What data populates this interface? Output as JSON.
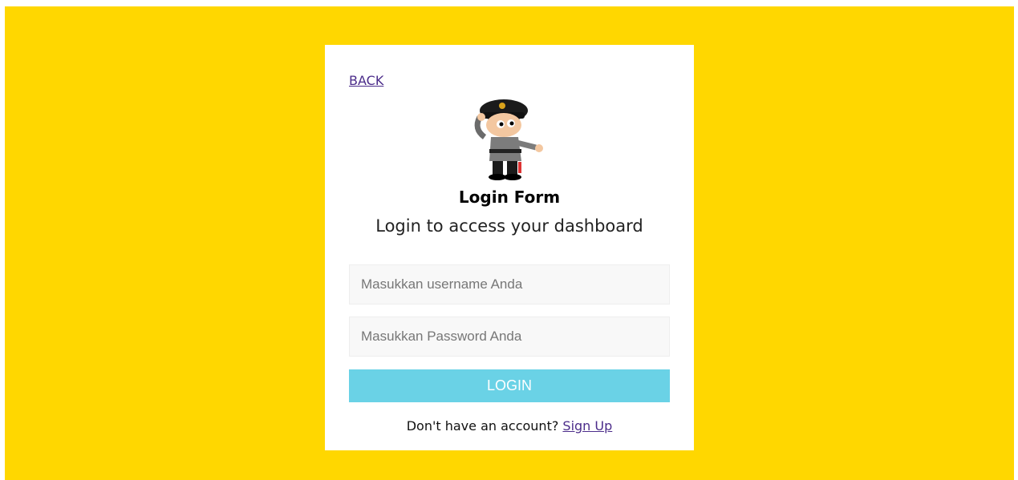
{
  "nav": {
    "back_label": "BACK"
  },
  "header": {
    "title": "Login Form",
    "subtitle": "Login to access your dashboard"
  },
  "form": {
    "username_placeholder": "Masukkan username Anda",
    "password_placeholder": "Masukkan Password Anda",
    "login_label": "LOGIN"
  },
  "footer": {
    "prompt": "Don't have an account?",
    "signup_label": "Sign Up"
  },
  "colors": {
    "background": "#FFD700",
    "card": "#FFFFFF",
    "button": "#6AD2E6",
    "link": "#4B2C8A"
  }
}
